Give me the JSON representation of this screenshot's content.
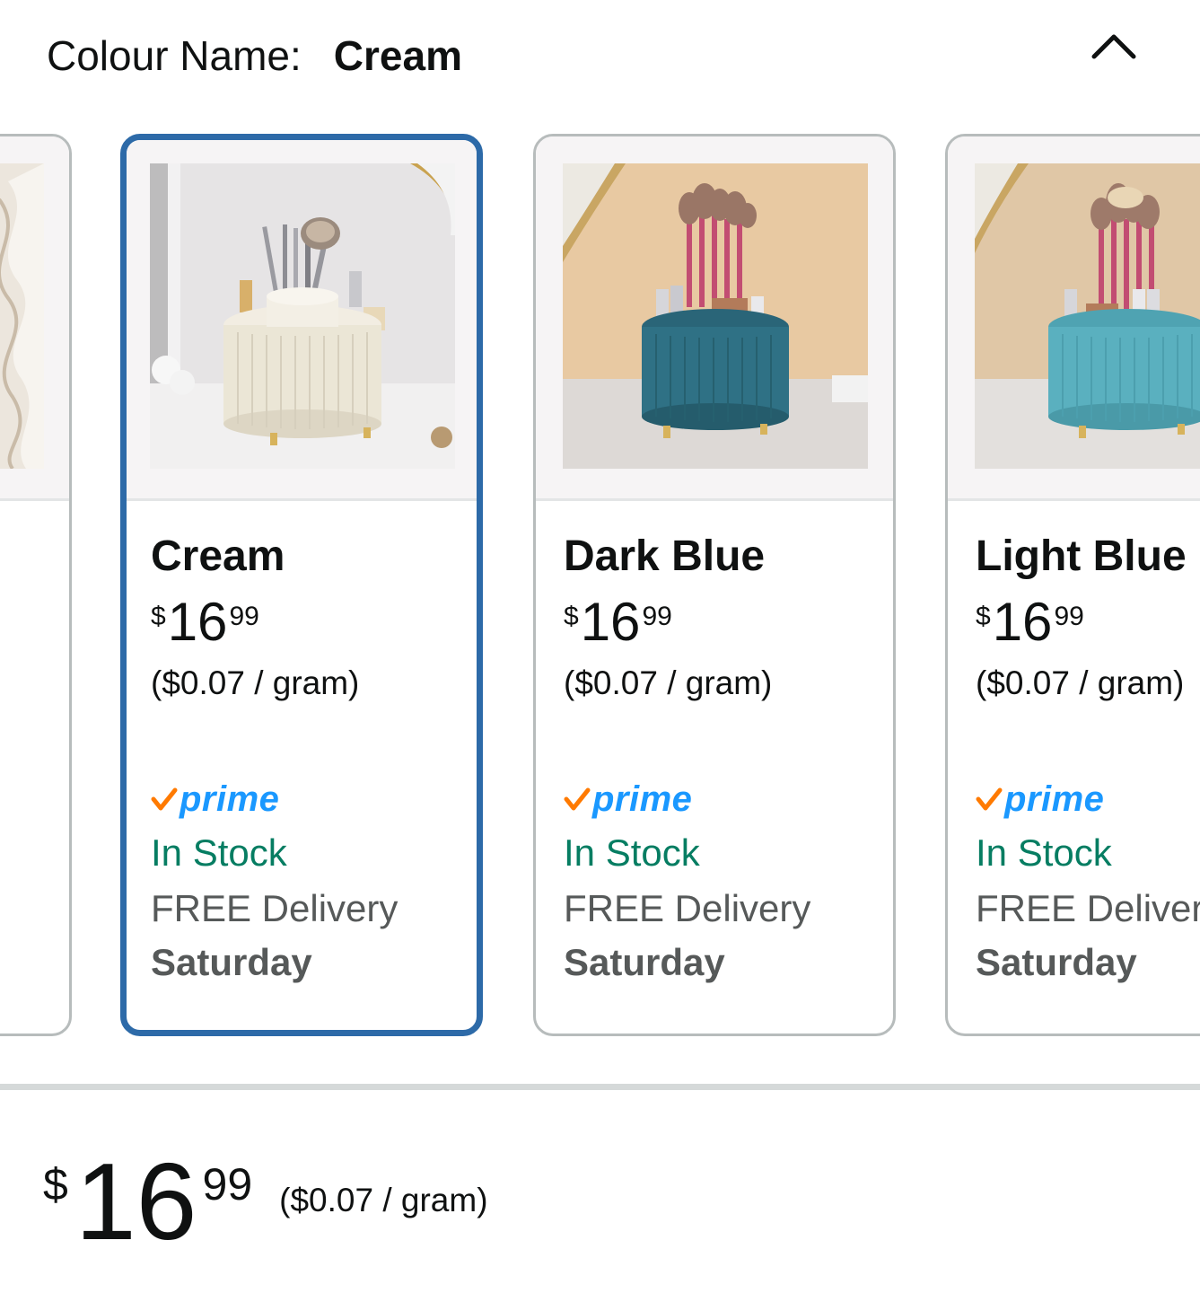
{
  "header": {
    "label": "Colour Name:",
    "selected_value": "Cream",
    "collapse_icon": "chevron-up-icon"
  },
  "swatches": [
    {
      "name": "",
      "partial": true
    },
    {
      "name": "Cream",
      "selected": true,
      "price": {
        "symbol": "$",
        "whole": "16",
        "fraction": "99"
      },
      "unit_price": "($0.07 / gram)",
      "prime": "prime",
      "stock": "In Stock",
      "delivery": "FREE Delivery",
      "delivery_day": "Saturday",
      "body_color": "#ebe6d6"
    },
    {
      "name": "Dark Blue",
      "selected": false,
      "price": {
        "symbol": "$",
        "whole": "16",
        "fraction": "99"
      },
      "unit_price": "($0.07 / gram)",
      "prime": "prime",
      "stock": "In Stock",
      "delivery": "FREE Delivery",
      "delivery_day": "Saturday",
      "body_color": "#2f7185"
    },
    {
      "name": "Light Blue",
      "selected": false,
      "price": {
        "symbol": "$",
        "whole": "16",
        "fraction": "99"
      },
      "unit_price": "($0.07 / gram)",
      "prime": "prime",
      "stock": "In Stock",
      "delivery": "FREE Delivery",
      "delivery_day": "Saturday",
      "body_color": "#5ab0bf"
    }
  ],
  "summary": {
    "price": {
      "symbol": "$",
      "whole": "16",
      "fraction": "99"
    },
    "unit_price": "($0.07 / gram)"
  },
  "colors": {
    "selected_border": "#2d6aa8",
    "card_border": "#b7bcbc",
    "prime_blue": "#1a98ff",
    "prime_check": "#ff7a00",
    "in_stock_green": "#067d62",
    "delivery_gray": "#565959"
  }
}
